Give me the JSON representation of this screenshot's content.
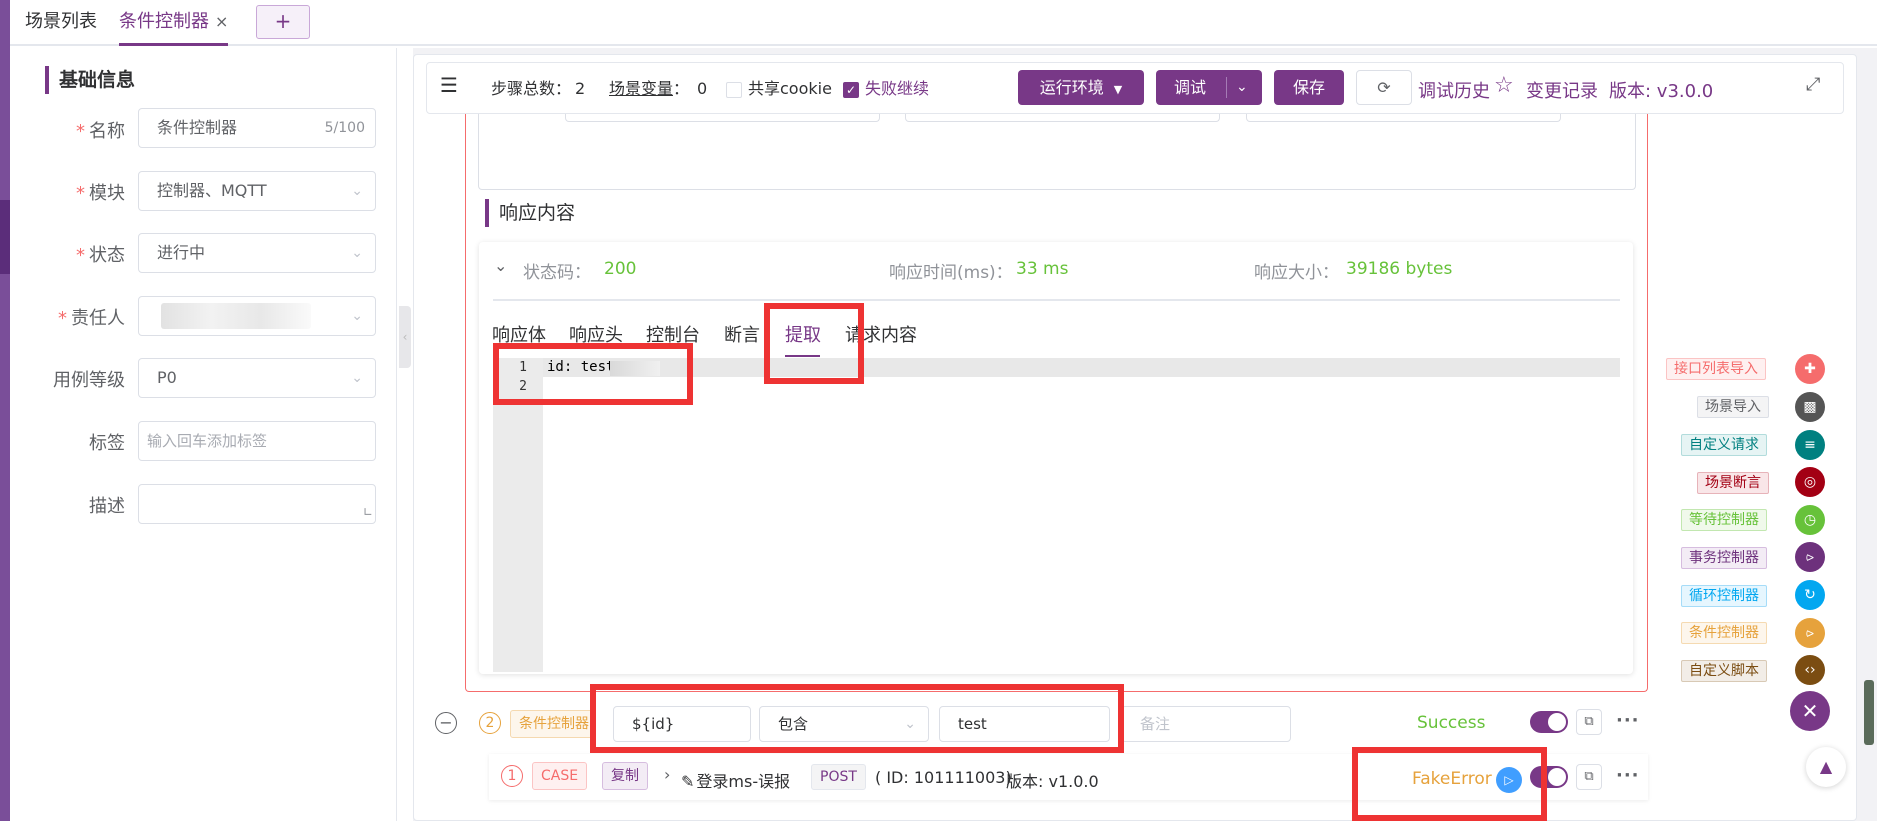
{
  "tabs": [
    {
      "label": "场景列表",
      "active": false
    },
    {
      "label": "条件控制器",
      "active": true
    }
  ],
  "tab_close": "×",
  "add_tab": "+",
  "basic_info": {
    "title": "基础信息",
    "name_label": "名称",
    "name_value": "条件控制器",
    "name_count": "5/100",
    "module_label": "模块",
    "module_value": "控制器、MQTT",
    "status_label": "状态",
    "status_value": "进行中",
    "owner_label": "责任人",
    "level_label": "用例等级",
    "level_value": "P0",
    "tags_label": "标签",
    "tags_placeholder": "输入回车添加标签",
    "desc_label": "描述"
  },
  "toolbar": {
    "steps_label": "步骤总数：",
    "steps_value": "2",
    "vars_label": "场景变量",
    "vars_sep": "：",
    "vars_value": "0",
    "share_cookie": "共享cookie",
    "fail_continue": "失败继续",
    "run_env": "运行环境",
    "debug": "调试",
    "save": "保存",
    "debug_history": "调试历史",
    "change_log": "变更记录",
    "version": "版本: v3.0.0"
  },
  "response": {
    "title": "响应内容",
    "status_label": "状态码：",
    "status_value": "200",
    "time_label": "响应时间(ms)：",
    "time_value": "33 ms",
    "size_label": "响应大小：",
    "size_value": "39186 bytes",
    "tabs": [
      "响应体",
      "响应头",
      "控制台",
      "断言",
      "提取",
      "请求内容"
    ],
    "active_tab": "提取",
    "lines": [
      "1",
      "2"
    ],
    "code_line1": "id: test"
  },
  "step2": {
    "index": "2",
    "type_label": "条件控制器",
    "variable": "${id}",
    "operator": "包含",
    "value": "test",
    "remark_placeholder": "备注",
    "result": "Success"
  },
  "step1": {
    "index": "1",
    "case_tag": "CASE",
    "copy_tag": "复制",
    "name": "登录ms-误报",
    "method": "POST",
    "id_info": "( ID: 101111003)",
    "version": "版本: v1.0.0",
    "result": "FakeError"
  },
  "right_actions": [
    {
      "label": "接口列表导入",
      "color": "#f56c6c",
      "bg": "#fef0f0",
      "icon": "plus-cross-icon"
    },
    {
      "label": "场景导入",
      "color": "#606266",
      "bg": "#f4f4f5",
      "icon": "film-icon"
    },
    {
      "label": "自定义请求",
      "color": "#008080",
      "bg": "#e6f4f4",
      "icon": "sliders-icon"
    },
    {
      "label": "场景断言",
      "color": "#a30014",
      "bg": "#f9e6e8",
      "icon": "assert-icon"
    },
    {
      "label": "等待控制器",
      "color": "#67c23a",
      "bg": "#f0f9eb",
      "icon": "clock-icon"
    },
    {
      "label": "事务控制器",
      "color": "#6d317c",
      "bg": "#f3ecf5",
      "icon": "fork-icon"
    },
    {
      "label": "循环控制器",
      "color": "#02a7f0",
      "bg": "#e6f6fe",
      "icon": "loop-icon"
    },
    {
      "label": "条件控制器",
      "color": "#e6a23c",
      "bg": "#fdf6ec",
      "icon": "branch-icon"
    },
    {
      "label": "自定义脚本",
      "color": "#7b4d12",
      "bg": "#f2ede7",
      "icon": "code-icon"
    }
  ]
}
